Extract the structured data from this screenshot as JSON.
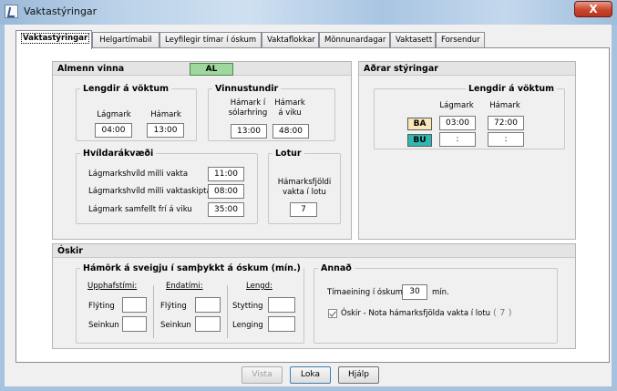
{
  "window": {
    "title": "Vaktastýringar",
    "close_label": "X"
  },
  "tabs": [
    "Vaktastýringar",
    "Helgartímabil",
    "Leyfilegir tímar í óskum",
    "Vaktaflokkar",
    "Mönnunardagar",
    "Vaktasett",
    "Forsendur"
  ],
  "almenn": {
    "title": "Almenn vinna",
    "code": "AL",
    "lengd": {
      "legend": "Lengdir á vöktum",
      "min_label": "Lágmark",
      "max_label": "Hámark",
      "min_value": "04:00",
      "max_value": "13:00"
    },
    "vinnu": {
      "legend": "Vinnustundir",
      "day_label": "Hámark í sólarhring",
      "week_label": "Hámark á viku",
      "day_value": "13:00",
      "week_value": "48:00"
    },
    "hvild": {
      "legend": "Hvíldarákvæði",
      "r1_label": "Lágmarkshvíld milli vakta",
      "r1_value": "11:00",
      "r2_label": "Lágmarkshvíld milli vaktaskipta",
      "r2_value": "08:00",
      "r3_label": "Lágmark samfellt frí  á viku",
      "r3_value": "35:00"
    },
    "lotur": {
      "legend": "Lotur",
      "label": "Hámarksfjöldi vakta í lotu",
      "value": "7"
    }
  },
  "adrar": {
    "title": "Aðrar stýringar",
    "legend": "Lengdir á vöktum",
    "min_label": "Lágmark",
    "max_label": "Hámark",
    "rows": [
      {
        "code": "BA",
        "color": "#fbe7b8",
        "min": "03:00",
        "max": "72:00"
      },
      {
        "code": "BU",
        "color": "#2fb7b2",
        "min": ":",
        "max": ":"
      }
    ]
  },
  "oskir": {
    "title": "Óskir",
    "hamork": {
      "legend": "Hámörk á sveigju í samþykkt á óskum (mín.)",
      "upphaf": {
        "title": "Upphafstími:",
        "r1": "Flýting",
        "r2": "Seinkun"
      },
      "enda": {
        "title": "Endatími:",
        "r1": "Flýting",
        "r2": "Seinkun"
      },
      "lengd": {
        "title": "Lengd:",
        "r1": "Stytting",
        "r2": "Lenging"
      }
    },
    "annad": {
      "legend": "Annað",
      "time_label": "Tímaeining í óskum",
      "time_value": "30",
      "time_unit": "mín.",
      "check_label": "Óskir - Nota hámarksfjölda vakta í lotu",
      "check_value": "( 7 )"
    }
  },
  "buttons": {
    "view": "Vista",
    "close": "Loka",
    "help": "Hjálp"
  }
}
